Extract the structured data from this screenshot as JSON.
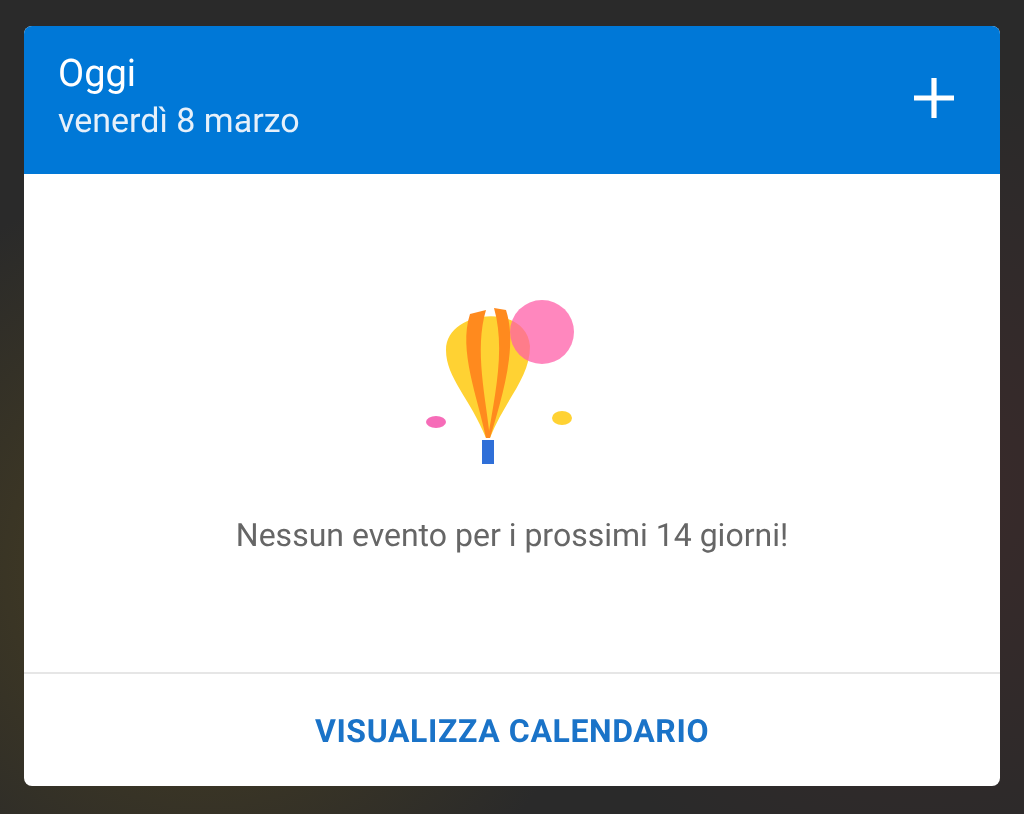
{
  "header": {
    "title": "Oggi",
    "date": "venerdì 8 marzo"
  },
  "empty_state": {
    "message": "Nessun evento per i prossimi 14 giorni!"
  },
  "footer": {
    "button": "VISUALIZZA CALENDARIO"
  }
}
